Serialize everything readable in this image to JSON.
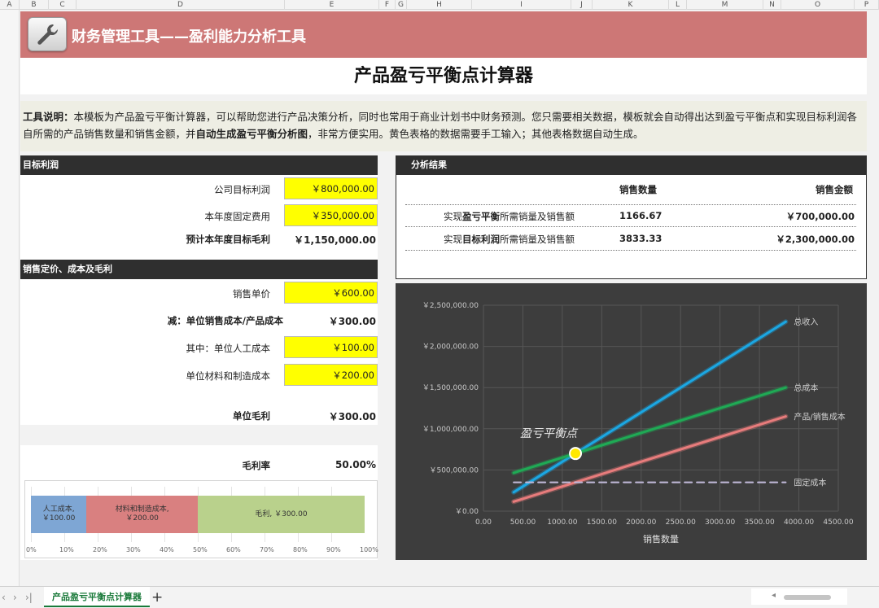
{
  "column_headers": [
    "A",
    "B",
    "C",
    "D",
    "E",
    "F",
    "G",
    "H",
    "I",
    "J",
    "K",
    "L",
    "M",
    "N",
    "O",
    "P"
  ],
  "banner": {
    "title": "财务管理工具——盈利能力分析工具",
    "color": "#cd7776"
  },
  "page_title": "产品盈亏平衡点计算器",
  "description": {
    "label": "工具说明：",
    "t1": "本模板为产品盈亏平衡计算器，可以帮助您进行产品决策分析，同时也常用于商业计划书中财务预测。您只需要相关数据，模板就会自动得出达到盈亏平衡点和实现",
    "t2": "目标利润各自所需的产品销售数量和销售金额，并",
    "bold": "自动生成盈亏平衡分析图",
    "t3": "，非常方便实用。黄色表格的数据需要手工输入；其他表格数据自动生成。"
  },
  "target_profit": {
    "header": "目标利润",
    "rows": [
      {
        "label": "公司目标利润",
        "value": "￥800,000.00",
        "input": true
      },
      {
        "label": "本年度固定费用",
        "value": "￥350,000.00",
        "input": true
      },
      {
        "label": "预计本年度目标毛利",
        "value": "￥1,150,000.00",
        "input": false
      }
    ]
  },
  "pricing": {
    "header": "销售定价、成本及毛利",
    "rows": [
      {
        "label": "销售单价",
        "value": "￥600.00",
        "input": true
      },
      {
        "label": "减：单位销售成本/产品成本",
        "value": "￥300.00",
        "input": false
      },
      {
        "label": "其中：单位人工成本",
        "value": "￥100.00",
        "input": true
      },
      {
        "label": "单位材料和制造成本",
        "value": "￥200.00",
        "input": true
      },
      {
        "label": "单位毛利",
        "value": "￥300.00",
        "input": false
      }
    ],
    "margin_label": "毛利率",
    "margin_value": "50.00%"
  },
  "stacked_bar": {
    "segments": [
      {
        "label": "人工成本,\n￥100.00",
        "value": 100,
        "color": "#7ea6d4"
      },
      {
        "label": "材料和制造成本,\n￥200.00",
        "value": 200,
        "color": "#d98080"
      },
      {
        "label": "毛利, ￥300.00",
        "value": 300,
        "color": "#b9d18c"
      }
    ],
    "ticks": [
      "0%",
      "10%",
      "20%",
      "30%",
      "40%",
      "50%",
      "60%",
      "70%",
      "80%",
      "90%",
      "100%"
    ]
  },
  "analysis": {
    "header": "分析结果",
    "col_qty": "销售数量",
    "col_amt": "销售金额",
    "rows": [
      {
        "prefix": "实现",
        "bold": "盈亏平衡",
        "suffix": "所需销量及销售额",
        "qty": "1166.67",
        "amt": "￥700,000.00"
      },
      {
        "prefix": "实现",
        "bold": "目标利润",
        "suffix": "所需销量及销售额",
        "qty": "3833.33",
        "amt": "￥2,300,000.00"
      }
    ]
  },
  "chart_data": {
    "type": "line",
    "xlabel": "销售数量",
    "ylabel": "",
    "xlim": [
      0,
      4500
    ],
    "ylim": [
      0,
      2500000
    ],
    "x_ticks": [
      "0.00",
      "500.00",
      "1000.00",
      "1500.00",
      "2000.00",
      "2500.00",
      "3000.00",
      "3500.00",
      "4000.00",
      "4500.00"
    ],
    "y_ticks": [
      "￥0.00",
      "￥500,000.00",
      "￥1,000,000.00",
      "￥1,500,000.00",
      "￥2,000,000.00",
      "￥2,500,000.00"
    ],
    "grid": true,
    "series": [
      {
        "name": "总收入",
        "color": "#1ba7e3",
        "x": [
          383.33,
          3833.33
        ],
        "y": [
          230000,
          2300000
        ]
      },
      {
        "name": "总成本",
        "color": "#1faa55",
        "x": [
          383.33,
          3833.33
        ],
        "y": [
          465000,
          1500000
        ]
      },
      {
        "name": "产品/销售成本",
        "color": "#e87c7c",
        "x": [
          383.33,
          3833.33
        ],
        "y": [
          115000,
          1150000
        ]
      },
      {
        "name": "固定成本",
        "color": "#c0b8d8",
        "dashed": true,
        "x": [
          383.33,
          3833.33
        ],
        "y": [
          350000,
          350000
        ]
      }
    ],
    "annotation": {
      "text": "盈亏平衡点",
      "x": 1166.67,
      "y": 700000,
      "color": "#ffe800"
    }
  },
  "tabs": {
    "sheet_name": "产品盈亏平衡点计算器",
    "add": "+"
  }
}
